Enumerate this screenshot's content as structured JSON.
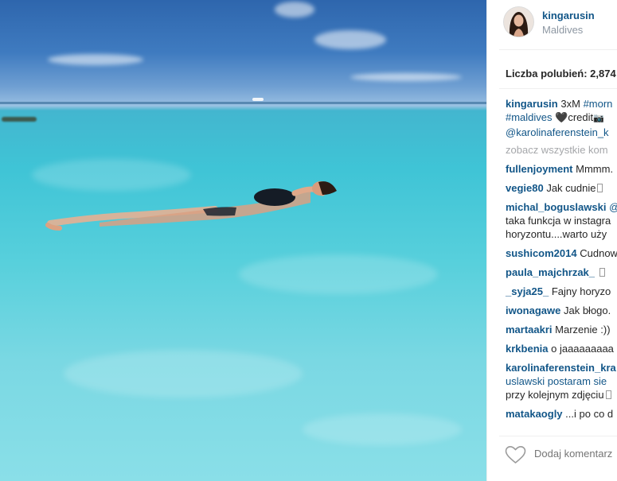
{
  "post": {
    "owner": "kingarusin",
    "location": "Maldives",
    "likes_label": "Liczba polubień: 2,874"
  },
  "caption": {
    "user": "kingarusin",
    "line1_text": "3xM",
    "line1_tag": "#morn",
    "line2_tag": "#maldives",
    "line2_text": "credit",
    "line3_mention": "@karolinaferenstein_k"
  },
  "view_all": "zobacz wszystkie kom",
  "comments": [
    {
      "user": "fullenjoyment",
      "text": "Mmmm."
    },
    {
      "user": "vegie80",
      "text": "Jak cudnie"
    },
    {
      "user": "michal_boguslawski",
      "text": "@",
      "line2": "taka funkcja w instagra",
      "line3": "horyzontu....warto uży"
    },
    {
      "user": "sushicom2014",
      "text": "Cudnow"
    },
    {
      "user": "paula_majchrzak_",
      "text": ""
    },
    {
      "user": "_syja25_",
      "text": "Fajny horyzo"
    },
    {
      "user": "iwonagawe",
      "text": "Jak błogo."
    },
    {
      "user": "martaakri",
      "text": "Marzenie :))"
    },
    {
      "user": "krkbenia",
      "text": "o jaaaaaaaaa"
    },
    {
      "user": "karolinaferenstein_kra",
      "line2": "uslawski postaram sie",
      "line3": "przy kolejnym zdjęciu"
    },
    {
      "user": "matakaogly",
      "text": "...i po co d"
    }
  ],
  "add_comment_placeholder": "Dodaj komentarz",
  "colors": {
    "username": "#125688",
    "muted": "#a5a7aa",
    "location": "#8d97a2"
  }
}
